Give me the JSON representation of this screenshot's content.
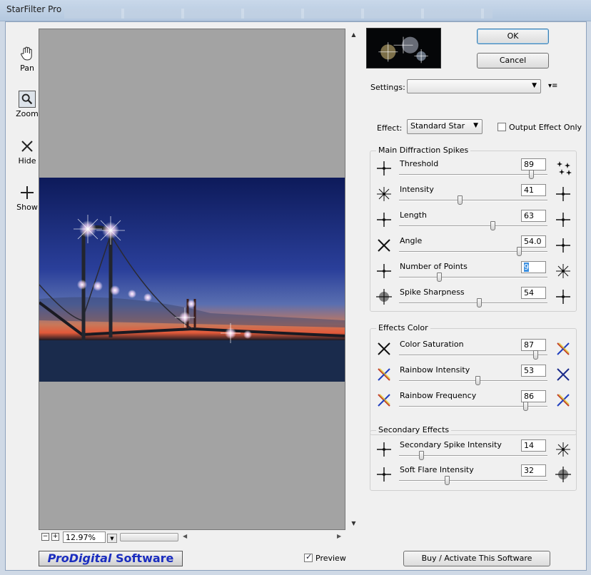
{
  "window": {
    "title": "StarFilter Pro"
  },
  "tools": [
    {
      "name": "pan",
      "label": "Pan",
      "icon": "hand-icon"
    },
    {
      "name": "zoom",
      "label": "Zoom",
      "icon": "magnifier-icon",
      "active": true
    },
    {
      "name": "hide",
      "label": "Hide",
      "icon": "x-icon"
    },
    {
      "name": "show",
      "label": "Show",
      "icon": "plus-icon"
    }
  ],
  "preview": {
    "zoom_value": "12.97%",
    "zoom_minus": "−",
    "zoom_plus": "+",
    "preview_label": "Preview",
    "preview_checked": true
  },
  "logo": {
    "part1": "Pro",
    "part2": "Digital",
    "part3": " Software"
  },
  "buttons": {
    "ok": "OK",
    "cancel": "Cancel",
    "buy": "Buy / Activate This Software"
  },
  "settings": {
    "label": "Settings:",
    "value": ""
  },
  "effect": {
    "label": "Effect:",
    "value": "Standard Star",
    "output_only_label": "Output Effect Only",
    "output_only_checked": false
  },
  "groups": {
    "main": {
      "title": "Main Diffraction Spikes",
      "rows": [
        {
          "label": "Threshold",
          "value": "89",
          "pos": 0.89
        },
        {
          "label": "Intensity",
          "value": "41",
          "pos": 0.41
        },
        {
          "label": "Length",
          "value": "63",
          "pos": 0.63
        },
        {
          "label": "Angle",
          "value": "54.0",
          "pos": 0.81
        },
        {
          "label": "Number of Points",
          "value": "9",
          "pos": 0.27,
          "selected": true
        },
        {
          "label": "Spike Sharpness",
          "value": "54",
          "pos": 0.54
        }
      ]
    },
    "color": {
      "title": "Effects Color",
      "rows": [
        {
          "label": "Color Saturation",
          "value": "87",
          "pos": 0.92
        },
        {
          "label": "Rainbow Intensity",
          "value": "53",
          "pos": 0.53
        },
        {
          "label": "Rainbow Frequency",
          "value": "86",
          "pos": 0.85
        }
      ]
    },
    "secondary": {
      "title": "Secondary Effects",
      "rows": [
        {
          "label": "Secondary Spike Intensity",
          "value": "14",
          "pos": 0.15
        },
        {
          "label": "Soft Flare Intensity",
          "value": "32",
          "pos": 0.32
        }
      ]
    }
  },
  "colors": {
    "accent": "#3c7fb1",
    "logo_text": "#1a2dbf",
    "selection": "#3b8fe0"
  }
}
